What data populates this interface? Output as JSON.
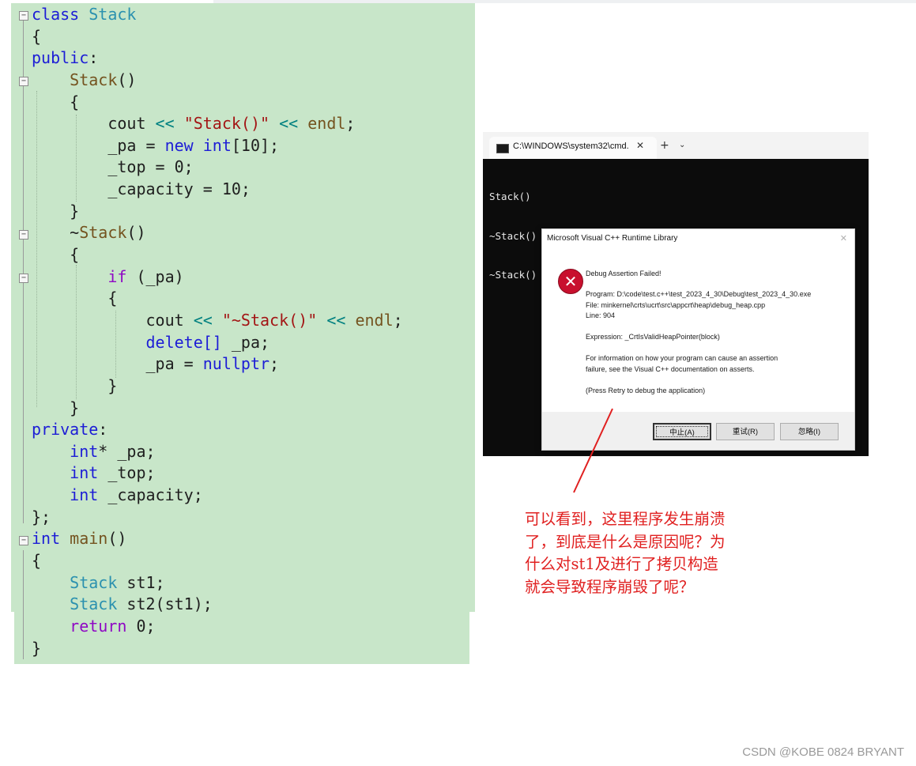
{
  "code": {
    "lines": [
      [
        {
          "t": "class ",
          "c": "kw"
        },
        {
          "t": "Stack",
          "c": "ty"
        }
      ],
      [
        {
          "t": "{",
          "c": "id"
        }
      ],
      [
        {
          "t": "public",
          "c": "kw"
        },
        {
          "t": ":",
          "c": "id"
        }
      ],
      [
        {
          "t": "    ",
          "c": "id"
        },
        {
          "t": "Stack",
          "c": "fn"
        },
        {
          "t": "()",
          "c": "id"
        }
      ],
      [
        {
          "t": "    {",
          "c": "id"
        }
      ],
      [
        {
          "t": "        cout ",
          "c": "id"
        },
        {
          "t": "<<",
          "c": "op"
        },
        {
          "t": " ",
          "c": "id"
        },
        {
          "t": "\"Stack()\"",
          "c": "st"
        },
        {
          "t": " ",
          "c": "id"
        },
        {
          "t": "<<",
          "c": "op"
        },
        {
          "t": " ",
          "c": "id"
        },
        {
          "t": "endl",
          "c": "fn"
        },
        {
          "t": ";",
          "c": "id"
        }
      ],
      [
        {
          "t": "        _pa = ",
          "c": "id"
        },
        {
          "t": "new",
          "c": "kw"
        },
        {
          "t": " ",
          "c": "id"
        },
        {
          "t": "int",
          "c": "kw"
        },
        {
          "t": "[10];",
          "c": "id"
        }
      ],
      [
        {
          "t": "        _top = 0;",
          "c": "id"
        }
      ],
      [
        {
          "t": "        _capacity = 10;",
          "c": "id"
        }
      ],
      [
        {
          "t": "    }",
          "c": "id"
        }
      ],
      [
        {
          "t": "    ~",
          "c": "id"
        },
        {
          "t": "Stack",
          "c": "fn"
        },
        {
          "t": "()",
          "c": "id"
        }
      ],
      [
        {
          "t": "    {",
          "c": "id"
        }
      ],
      [
        {
          "t": "        ",
          "c": "id"
        },
        {
          "t": "if",
          "c": "ctl"
        },
        {
          "t": " (_pa)",
          "c": "id"
        }
      ],
      [
        {
          "t": "        {",
          "c": "id"
        }
      ],
      [
        {
          "t": "            cout ",
          "c": "id"
        },
        {
          "t": "<<",
          "c": "op"
        },
        {
          "t": " ",
          "c": "id"
        },
        {
          "t": "\"~Stack()\"",
          "c": "st"
        },
        {
          "t": " ",
          "c": "id"
        },
        {
          "t": "<<",
          "c": "op"
        },
        {
          "t": " ",
          "c": "id"
        },
        {
          "t": "endl",
          "c": "fn"
        },
        {
          "t": ";",
          "c": "id"
        }
      ],
      [
        {
          "t": "            ",
          "c": "id"
        },
        {
          "t": "delete[]",
          "c": "kw"
        },
        {
          "t": " _pa;",
          "c": "id"
        }
      ],
      [
        {
          "t": "            _pa = ",
          "c": "id"
        },
        {
          "t": "nullptr",
          "c": "kw"
        },
        {
          "t": ";",
          "c": "id"
        }
      ],
      [
        {
          "t": "        }",
          "c": "id"
        }
      ],
      [
        {
          "t": "    }",
          "c": "id"
        }
      ],
      [
        {
          "t": "private",
          "c": "kw"
        },
        {
          "t": ":",
          "c": "id"
        }
      ],
      [
        {
          "t": "    ",
          "c": "id"
        },
        {
          "t": "int",
          "c": "kw"
        },
        {
          "t": "* _pa;",
          "c": "id"
        }
      ],
      [
        {
          "t": "    ",
          "c": "id"
        },
        {
          "t": "int",
          "c": "kw"
        },
        {
          "t": " _top;",
          "c": "id"
        }
      ],
      [
        {
          "t": "    ",
          "c": "id"
        },
        {
          "t": "int",
          "c": "kw"
        },
        {
          "t": " _capacity;",
          "c": "id"
        }
      ],
      [
        {
          "t": "};",
          "c": "id"
        }
      ],
      [
        {
          "t": "int",
          "c": "kw"
        },
        {
          "t": " ",
          "c": "id"
        },
        {
          "t": "main",
          "c": "fn"
        },
        {
          "t": "()",
          "c": "id"
        }
      ],
      [
        {
          "t": "{",
          "c": "id"
        }
      ],
      [
        {
          "t": "    ",
          "c": "id"
        },
        {
          "t": "Stack",
          "c": "ty"
        },
        {
          "t": " st1;",
          "c": "id"
        }
      ],
      [
        {
          "t": "    ",
          "c": "id"
        },
        {
          "t": "Stack",
          "c": "ty"
        },
        {
          "t": " st2(st1);",
          "c": "id"
        }
      ],
      [
        {
          "t": "    ",
          "c": "id"
        },
        {
          "t": "return",
          "c": "ctl"
        },
        {
          "t": " 0;",
          "c": "id"
        }
      ],
      [
        {
          "t": "}",
          "c": "id"
        }
      ]
    ],
    "fold_glyph": "−"
  },
  "console": {
    "tab_title": "C:\\WINDOWS\\system32\\cmd.",
    "close_glyph": "✕",
    "new_tab_glyph": "+",
    "dropdown_glyph": "⌄",
    "lines": [
      "Stack()",
      "~Stack()",
      "~Stack()"
    ]
  },
  "dialog": {
    "title": "Microsoft Visual C++ Runtime Library",
    "close_glyph": "✕",
    "icon_glyph": "✕",
    "heading": "Debug Assertion Failed!",
    "program": "Program: D:\\code\\test.c++\\test_2023_4_30\\Debug\\test_2023_4_30.exe",
    "file": "File: minkernel\\crts\\ucrt\\src\\appcrt\\heap\\debug_heap.cpp",
    "line": "Line: 904",
    "expression": "Expression: _CrtIsValidHeapPointer(block)",
    "info1": "For information on how your program can cause an assertion",
    "info2": "failure, see the Visual C++ documentation on asserts.",
    "retry_hint": "(Press Retry to debug the application)",
    "buttons": {
      "abort": "中止(A)",
      "retry": "重试(R)",
      "ignore": "忽略(I)"
    }
  },
  "annotation": {
    "color": "#e02020",
    "lines": [
      "可以看到，这里程序发生崩溃",
      "了，到底是什么是原因呢？为",
      "什么对st1及进行了拷贝构造",
      "就会导致程序崩毁了呢？"
    ]
  },
  "watermark": "CSDN @KOBE 0824 BRYANT"
}
